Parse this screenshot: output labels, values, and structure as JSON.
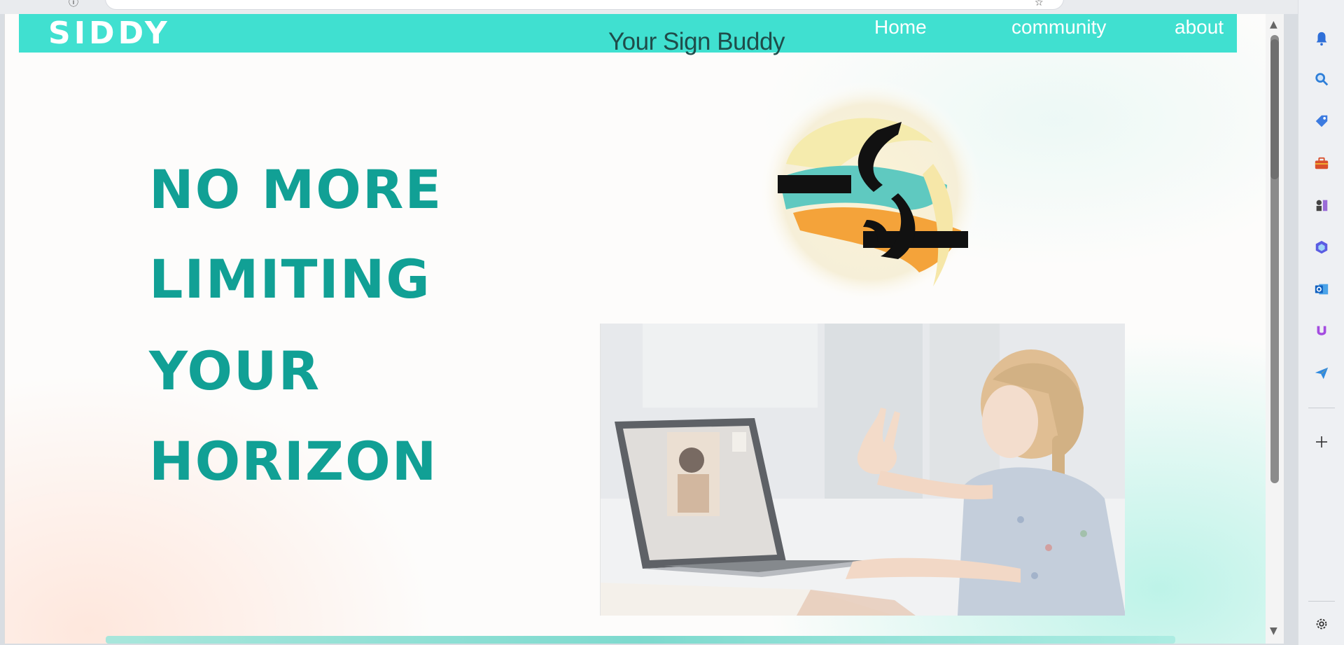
{
  "navbar": {
    "brand": "SIDDY",
    "tagline": "Your Sign Buddy",
    "links": [
      "Home",
      "community",
      "about"
    ]
  },
  "hero": {
    "lines": [
      "NO MORE",
      "LIMITING",
      "YOUR",
      "HORIZON"
    ]
  },
  "colors": {
    "navbar": "#40e0d0",
    "heading": "#11a095",
    "tagline": "#1f4c4a"
  },
  "sidebar": {
    "icons": [
      "bell-icon",
      "search-icon",
      "tag-icon",
      "toolbox-icon",
      "chess-icon",
      "copilot-icon",
      "outlook-icon",
      "magnet-icon",
      "send-icon",
      "add-icon",
      "settings-icon"
    ]
  }
}
